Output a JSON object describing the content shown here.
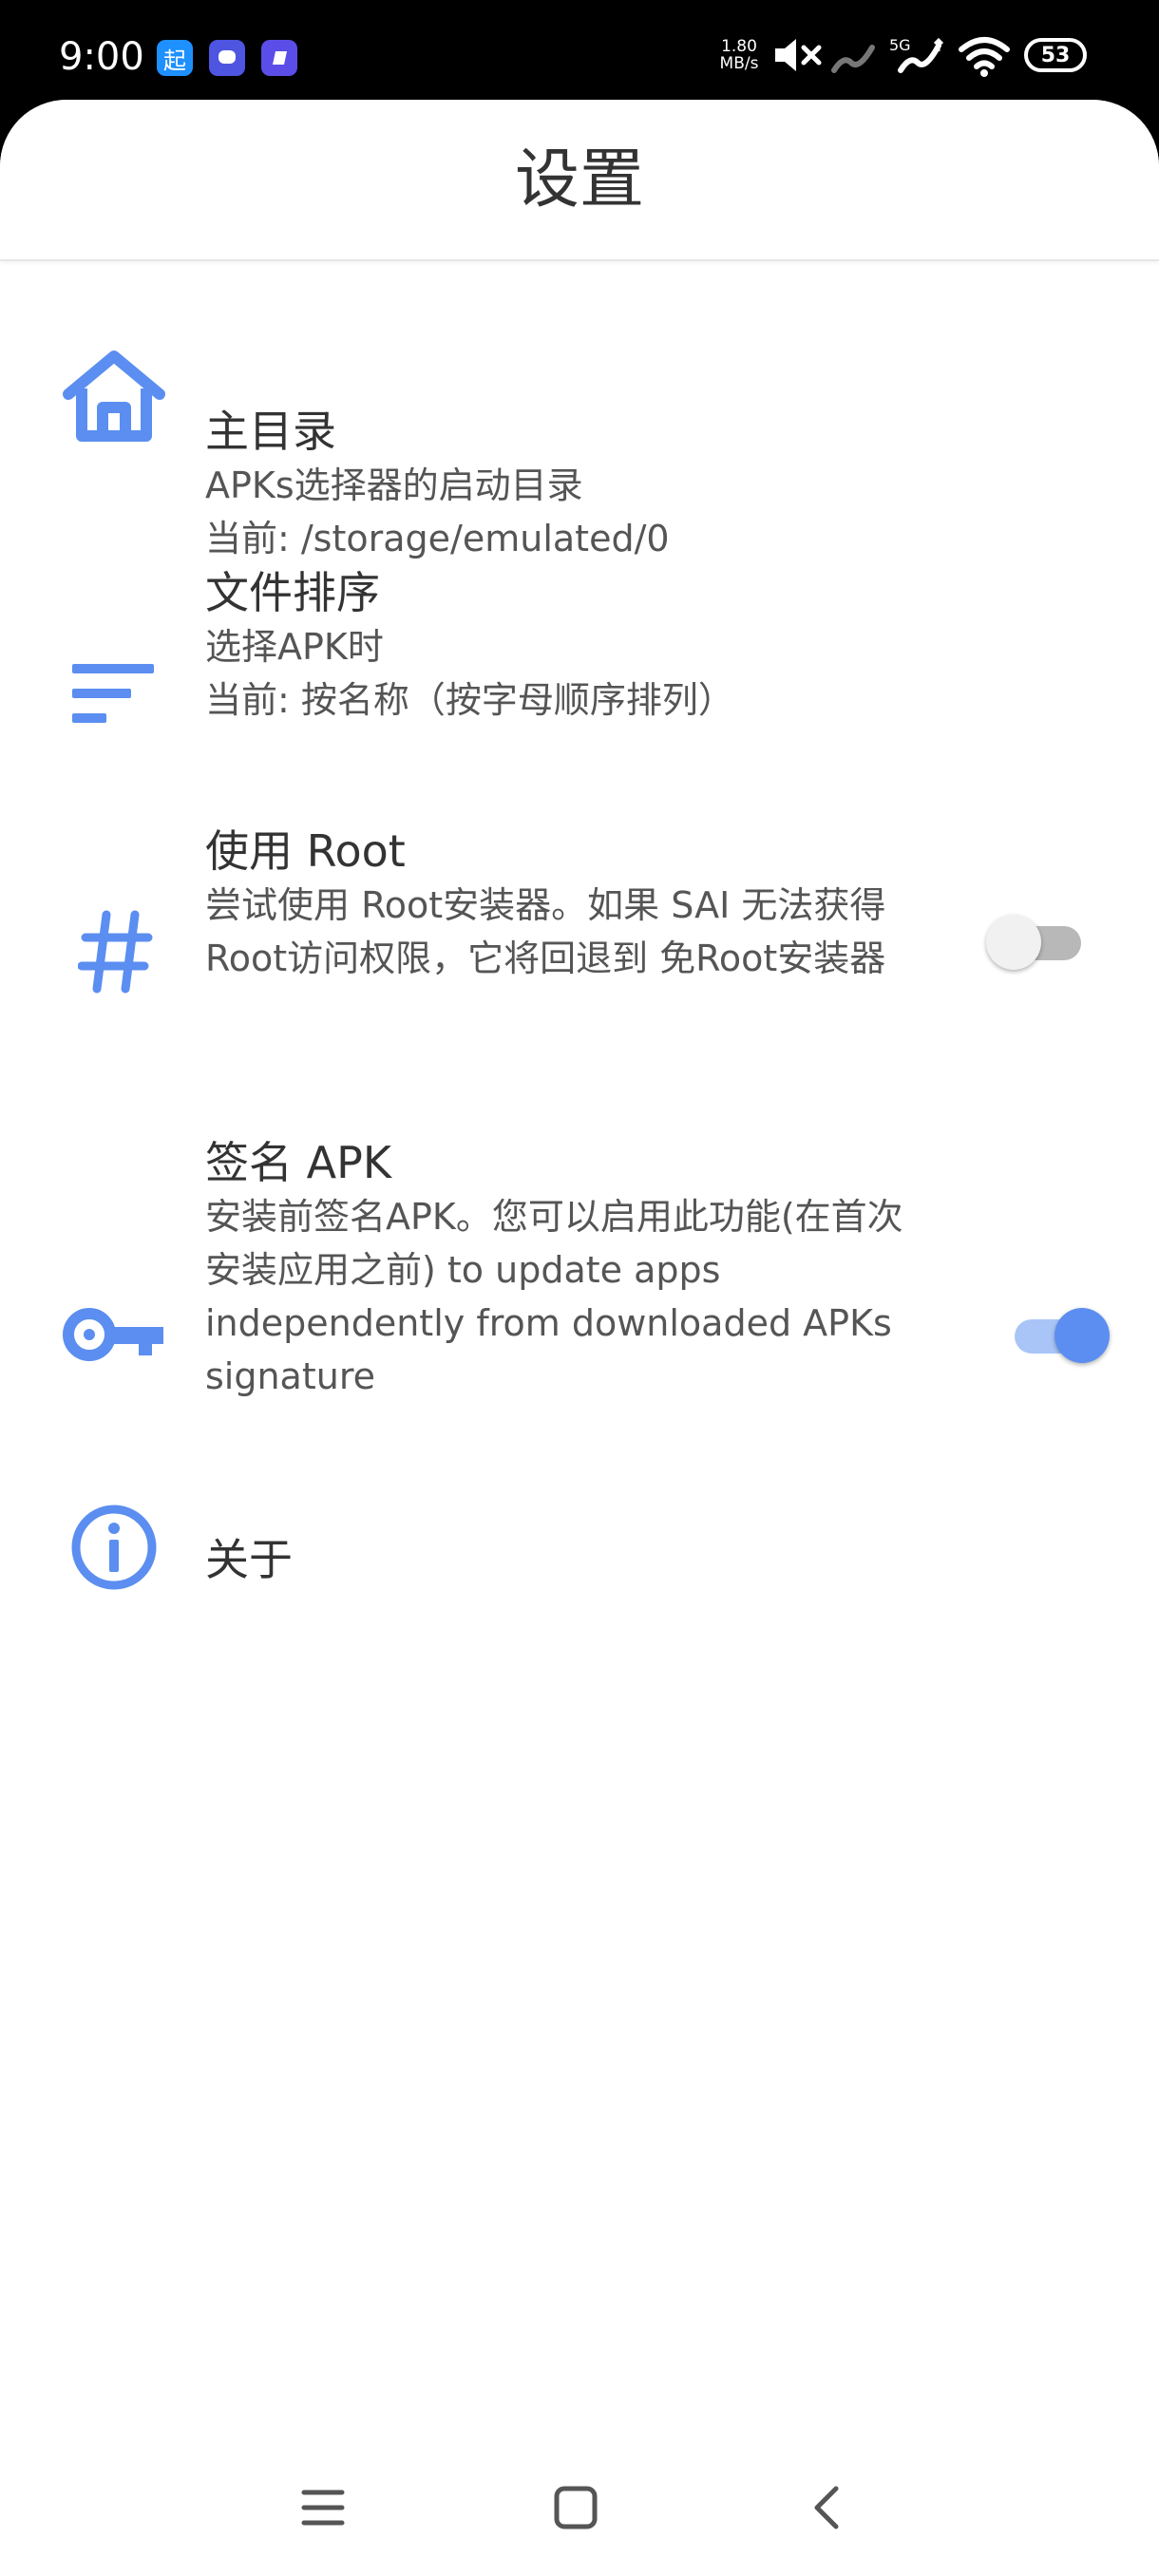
{
  "status_bar": {
    "time": "9:00",
    "app_badge_1": "起",
    "net_speed_value": "1.80",
    "net_speed_unit": "MB/s",
    "net_label": "5G",
    "battery": "53"
  },
  "header": {
    "title": "设置"
  },
  "preferences": [
    {
      "title": "主目录",
      "summary": "APKs选择器的启动目录\n当前: /storage/emulated/0",
      "icon": "home-icon"
    },
    {
      "title": "文件排序",
      "summary": "选择APK时\n当前: 按名称（按字母顺序排列）",
      "icon": "sort-icon"
    },
    {
      "title": "使用 Root",
      "summary": "尝试使用 Root安装器。如果 SAI 无法获得 Root访问权限，它将回退到 免Root安装器",
      "icon": "hash-icon",
      "switch_on": false
    },
    {
      "title": "签名 APK",
      "summary": "安装前签名APK。您可以启用此功能(在首次安装应用之前) to update apps independently from downloaded APKs signature",
      "icon": "key-icon",
      "switch_on": true
    },
    {
      "title": "关于",
      "summary": "",
      "icon": "info-icon"
    }
  ],
  "colors": {
    "accent": "#5b8ef0",
    "title_text": "#333333",
    "summary_text": "#555555"
  },
  "nav": {
    "icons": [
      "menu-icon",
      "home-square-icon",
      "back-icon"
    ]
  }
}
